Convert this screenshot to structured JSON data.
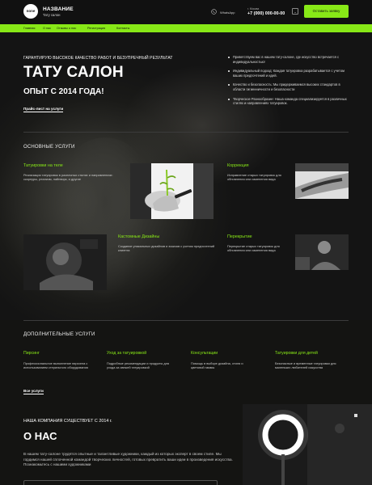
{
  "header": {
    "logo_text": "none",
    "brand_name": "НАЗВАНИЕ",
    "brand_sub": "Тату салон",
    "whatsapp_label": "WhatsApp",
    "city": "г. Москва",
    "phone": "+7 (000) 000-00-00",
    "cta_label": "Оставить заявку"
  },
  "nav": {
    "items": [
      "Главная",
      "О нас",
      "Отзывы о нас",
      "Регистрация",
      "Контакты"
    ]
  },
  "hero": {
    "subtitle": "ГАРАНТИРУЮ ВЫСОКОЕ КАЧЕСТВО РАБОТ И БЕЗУПРЕЧНЫЙ РЕЗУЛЬТАТ",
    "title": "ТАТУ САЛОН",
    "since": "ОПЫТ С 2014 ГОДА!",
    "price_link": "Прайс-лист на услуги",
    "bullets": [
      "Приветствуем вас в нашем тату-салоне, где искусство встречается с индивидуальностью!",
      "Индивидуальный подход: Каждая татуировка разрабатывается с учетом ваших предпочтений и идей.",
      "Качество и безопасность: Мы придерживаемся высоких стандартов в области гигиенничности и безопасности",
      "Творческое Разнообразие: Наша команда специализируется в различных стилях и направлениях татуировок."
    ]
  },
  "services": {
    "heading": "ОСНОВНЫЕ УСЛУГИ",
    "items": [
      {
        "title": "Татуировки на теле",
        "text": "Реализация татуировок в различных стилях и направлениях: скорпуры, реализм, лайнворк, и другие"
      },
      {
        "title": "Коррекция",
        "text": "Исправление старых татуировок для обновления или изменения вида"
      },
      {
        "title": "Кастомные Дизайны",
        "text": "Создание уникальных дизайнов и эскизов с учетом предпочтений клиента"
      },
      {
        "title": "Перекрытие",
        "text": "Перекрытие старых татуировок для обновления или изменения вида"
      }
    ]
  },
  "additional": {
    "heading": "ДОПОЛНИТЕЛЬНЫЕ УСЛУГИ",
    "items": [
      {
        "title": "Пирсинг",
        "text": "Профессиональное выполнение пирсинга с использованием стерильного оборудования"
      },
      {
        "title": "Уход за татуировкой",
        "text": "Подробные рекомендации и продукты для ухода за свежей татуировкой"
      },
      {
        "title": "Консультации",
        "text": "Помощь в выборе дизайна, стиля и цветовой гаммы"
      },
      {
        "title": "Татуировки для детей",
        "text": "Безопасные и временные татуировки для маленьких любителей искусства"
      }
    ],
    "all_link": "Все услуги"
  },
  "about": {
    "subtitle": "НАША КОМПАНИЯ СУЩЕСТВУЕТ С 2014 г.",
    "title": "О НАС",
    "text": "В нашем тату-салоне трудятся опытные и талантливые художники, каждый из которых эксперт в своем стиле. Мы гордимся нашей сплоченной командой творческих личностей, готовых превратить ваши идеи в произведения искусства. Познакомьтесь с нашими художниками"
  },
  "colors": {
    "accent": "#88e817",
    "background": "#0e0e0e",
    "text": "#ffffff"
  }
}
